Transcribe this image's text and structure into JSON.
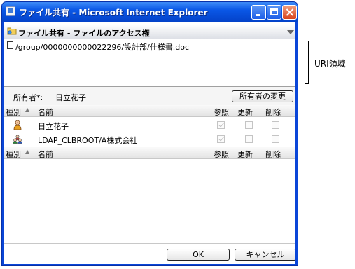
{
  "window": {
    "title": "ファイル共有 - Microsoft Internet Explorer"
  },
  "dialog": {
    "header_title": "ファイル共有 - ファイルのアクセス権",
    "uri": "/group/0000000000022296/設計部/仕様書.doc",
    "owner_label": "所有者*:",
    "owner_name": "日立花子",
    "change_owner_button": "所有者の変更",
    "columns": {
      "type": "種別",
      "name": "名前",
      "ref": "参照",
      "update": "更新",
      "delete": "削除"
    },
    "rows": [
      {
        "name": "日立花子",
        "icon": "user-icon",
        "ref": true,
        "update": false,
        "delete": false
      },
      {
        "name": "LDAP_CLBROOT/A株式会社",
        "icon": "group-icon",
        "ref": true,
        "update": false,
        "delete": false
      }
    ],
    "ok_button": "OK",
    "cancel_button": "キャンセル"
  },
  "annotation": {
    "uri_area_label": "URI領域"
  }
}
